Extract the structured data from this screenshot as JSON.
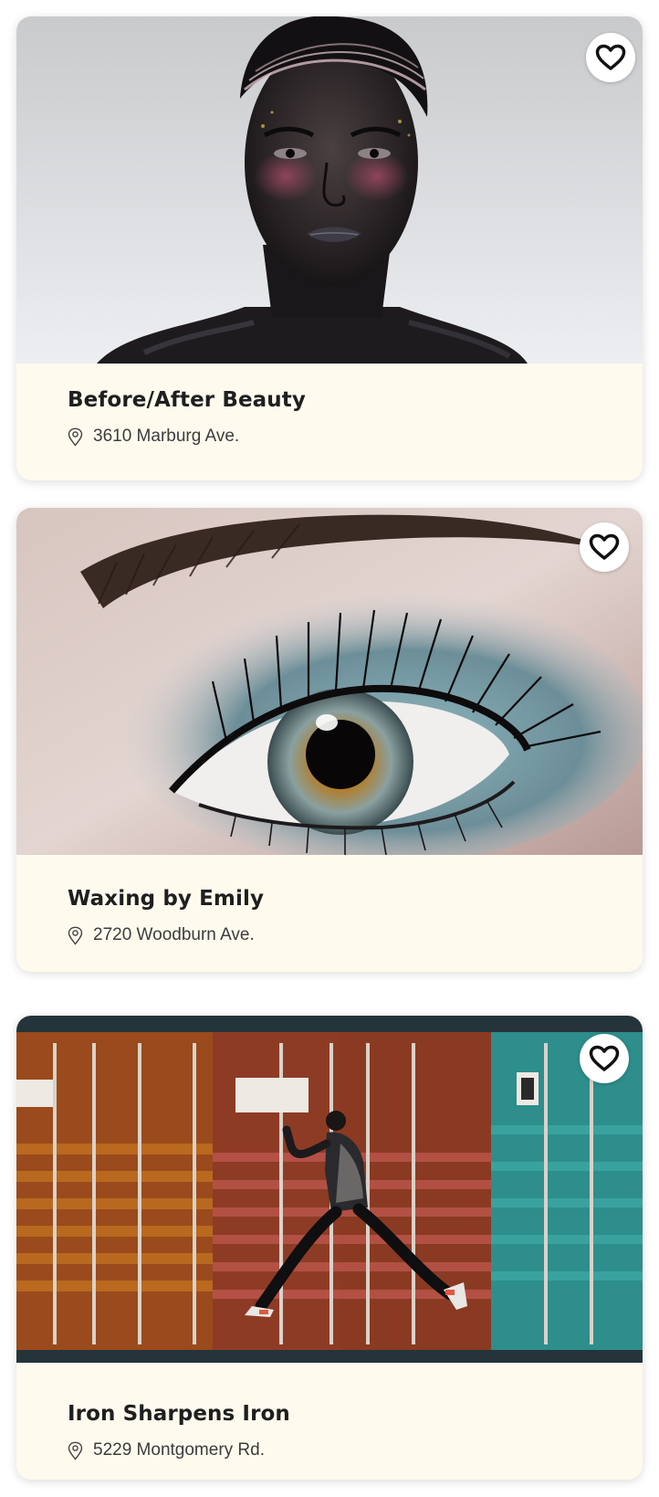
{
  "listings": [
    {
      "name": "Before/After Beauty",
      "address": "3610 Marburg Ave.",
      "photo": "portrait-model-metallic-makeup",
      "favorite_icon": "heart-outline-icon",
      "address_icon": "map-pin-icon"
    },
    {
      "name": "Waxing by Emily",
      "address": "2720 Woodburn Ave.",
      "photo": "eye-closeup-makeup",
      "favorite_icon": "heart-outline-icon",
      "address_icon": "map-pin-icon"
    },
    {
      "name": "Iron Sharpens Iron",
      "address": "5229 Montgomery Rd.",
      "photo": "man-leaping-shipping-containers",
      "favorite_icon": "heart-outline-icon",
      "address_icon": "map-pin-icon"
    }
  ],
  "colors": {
    "card_background": "#fefbee",
    "page_background": "#ffffff",
    "title_text": "#1f1f1f",
    "address_text": "#3c3c3c"
  }
}
